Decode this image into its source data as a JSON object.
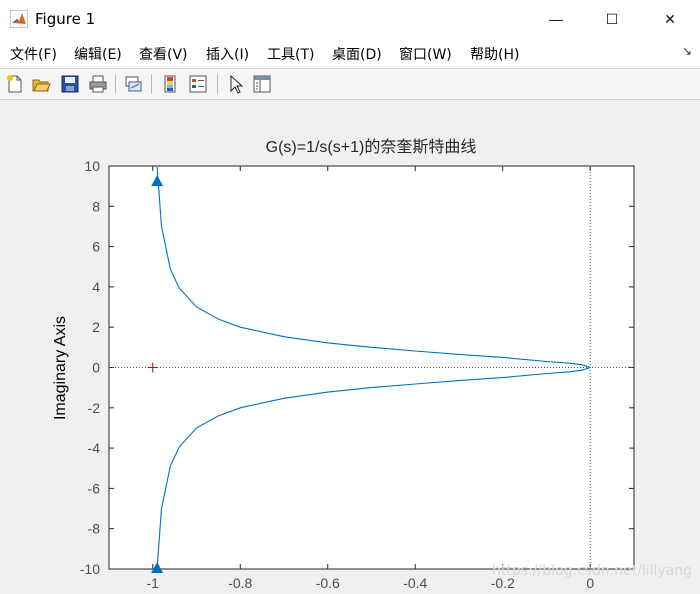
{
  "window": {
    "title": "Figure 1",
    "controls": {
      "minimize": "—",
      "maximize": "☐",
      "close": "✕"
    }
  },
  "menu": {
    "items": [
      "文件(F)",
      "编辑(E)",
      "查看(V)",
      "插入(I)",
      "工具(T)",
      "桌面(D)",
      "窗口(W)",
      "帮助(H)"
    ],
    "undock": "↘"
  },
  "toolbar": {
    "icons": [
      "new-figure-icon",
      "open-file-icon",
      "save-icon",
      "print-icon",
      "link-plot-icon",
      "insert-colorbar-icon",
      "insert-legend-icon",
      "edit-plot-icon",
      "property-inspector-icon"
    ]
  },
  "chart_data": {
    "type": "line",
    "title": "G(s)=1/s(s+1)的奈奎斯特曲线",
    "xlabel": "",
    "ylabel": "Imaginary Axis",
    "xlim": [
      -1.1,
      0.1
    ],
    "ylim": [
      -10,
      10
    ],
    "xticks": [
      -1,
      -0.8,
      -0.6,
      -0.4,
      -0.2,
      0
    ],
    "xtick_labels": [
      "-1",
      "-0.8",
      "-0.6",
      "-0.4",
      "-0.2",
      "0"
    ],
    "yticks": [
      10,
      8,
      6,
      4,
      2,
      0,
      -2,
      -4,
      -6,
      -8,
      -10
    ],
    "ytick_labels": [
      "10",
      "8",
      "6",
      "4",
      "2",
      "0",
      "-2",
      "-4",
      "-6",
      "-8",
      "-10"
    ],
    "series": [
      {
        "color": "#0072bd",
        "points": [
          [
            -0.99,
            9.95
          ],
          [
            -0.98,
            7.0
          ],
          [
            -0.96,
            4.9
          ],
          [
            -0.94,
            3.96
          ],
          [
            -0.9,
            3.0
          ],
          [
            -0.85,
            2.4
          ],
          [
            -0.8,
            2.0
          ],
          [
            -0.7,
            1.53
          ],
          [
            -0.6,
            1.22
          ],
          [
            -0.5,
            1.0
          ],
          [
            -0.4,
            0.82
          ],
          [
            -0.3,
            0.65
          ],
          [
            -0.2,
            0.5
          ],
          [
            -0.1,
            0.3
          ],
          [
            -0.05,
            0.22
          ],
          [
            -0.02,
            0.14
          ],
          [
            0,
            0
          ]
        ],
        "mirror_about_x_axis": true
      }
    ],
    "direction_arrows": [
      [
        -0.99,
        9.3
      ],
      [
        -0.99,
        -9.9
      ]
    ],
    "critical_point": {
      "x": -1,
      "y": 0,
      "marker": "+",
      "color": "#cc0000"
    },
    "reference_lines": {
      "x": 0,
      "y": 0,
      "style": "dotted"
    },
    "grid": false
  },
  "watermark": "https://blog.csdn.net/lillyang"
}
